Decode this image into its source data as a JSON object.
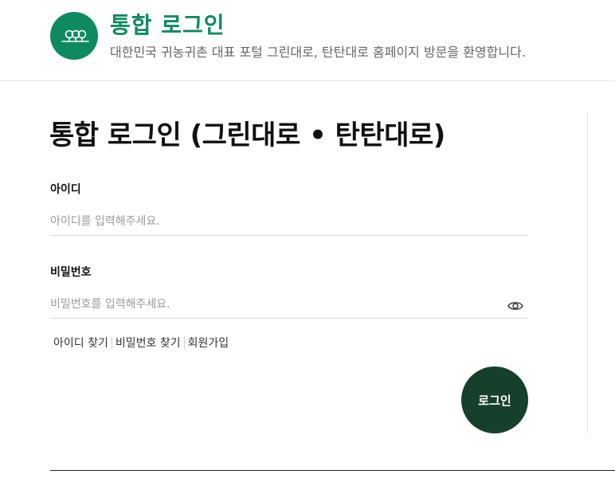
{
  "header": {
    "title": "통합 로그인",
    "subtitle": "대한민국 귀농귀촌 대표 포털 그린대로, 탄탄대로 홈페이지 방문을 환영합니다.",
    "logo_icon": "trees-icon",
    "brand_color": "#0e8a5f"
  },
  "main": {
    "title": "통합 로그인 (그린대로 • 탄탄대로)",
    "id_field": {
      "label": "아이디",
      "placeholder": "아이디를 입력해주세요.",
      "value": ""
    },
    "password_field": {
      "label": "비밀번호",
      "placeholder": "비밀번호를 입력해주세요.",
      "value": "",
      "toggle_icon": "eye-icon"
    },
    "links": {
      "find_id": "아이디 찾기",
      "find_password": "비밀번호 찾기",
      "signup": "회원가입"
    },
    "login_button": "로그인",
    "button_color": "#17402c"
  }
}
